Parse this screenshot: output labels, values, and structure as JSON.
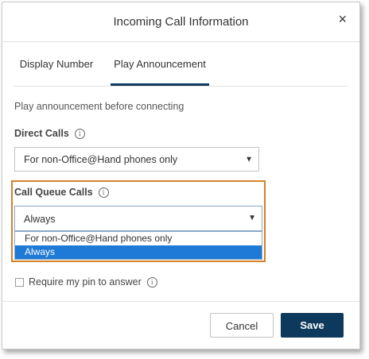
{
  "dialog": {
    "title": "Incoming Call Information",
    "close_glyph": "×"
  },
  "tabs": [
    {
      "label": "Display Number",
      "active": false
    },
    {
      "label": "Play Announcement",
      "active": true
    }
  ],
  "intro_text": "Play announcement before connecting",
  "direct_calls": {
    "label": "Direct Calls",
    "selected": "For non-Office@Hand phones only"
  },
  "call_queue_calls": {
    "label": "Call Queue Calls",
    "selected": "Always",
    "options": [
      "For non-Office@Hand phones only",
      "Always"
    ],
    "highlighted_option": "Always"
  },
  "require_pin": {
    "label": "Require my pin to answer",
    "checked": false
  },
  "buttons": {
    "cancel": "Cancel",
    "save": "Save"
  },
  "icons": {
    "info": "i",
    "caret": "▼"
  },
  "colors": {
    "primary": "#0d3a5c",
    "highlight_box": "#d7802b",
    "selected_option": "#1e7ad6"
  }
}
